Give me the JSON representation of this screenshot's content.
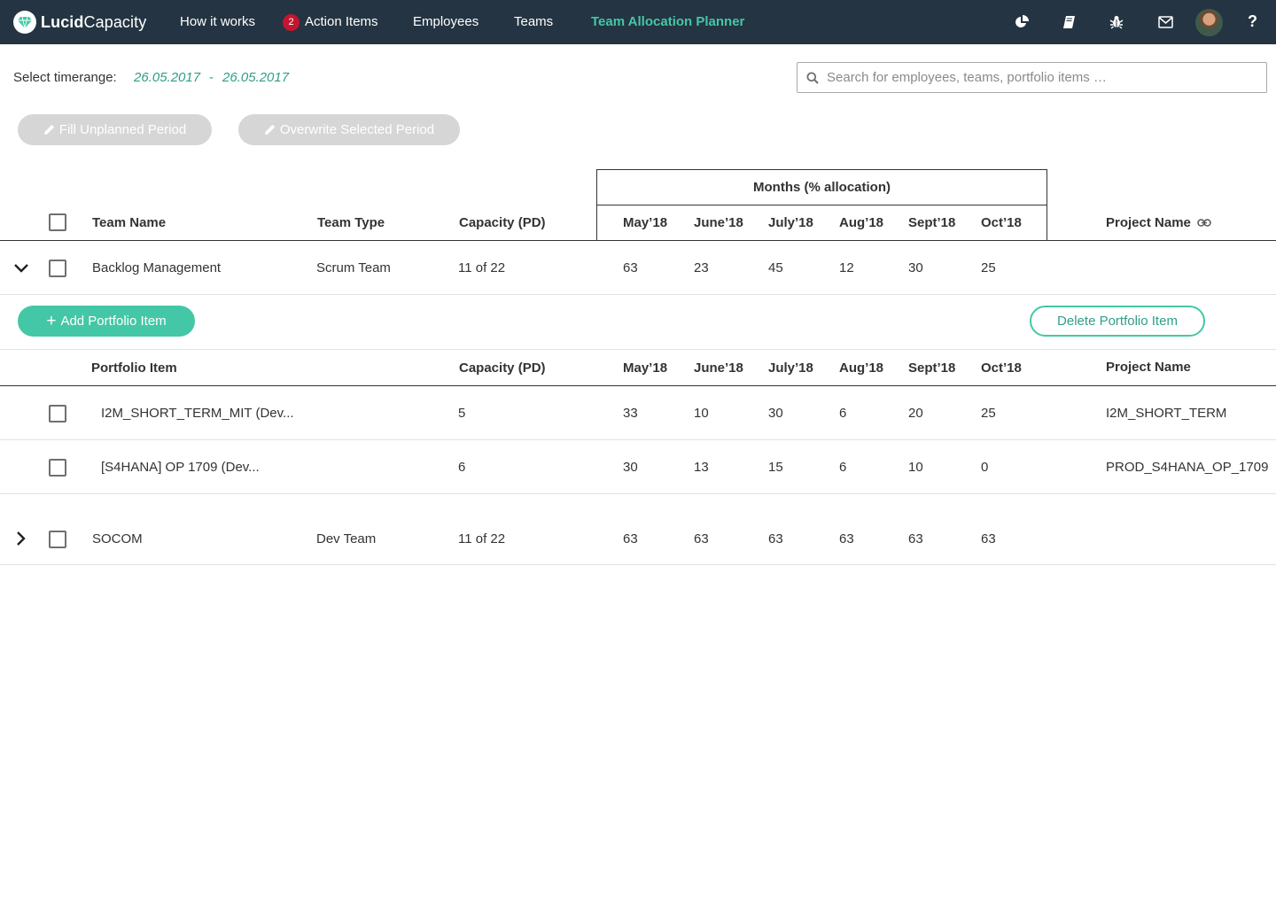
{
  "brand": {
    "name_bold": "Lucid",
    "name_light": "Capacity"
  },
  "nav": {
    "how_it_works": "How it works",
    "action_items_count": "2",
    "action_items": "Action Items",
    "employees": "Employees",
    "teams": "Teams",
    "planner": "Team Allocation Planner"
  },
  "toolbar_icons": [
    "pie-chart-icon",
    "book-icon",
    "bug-icon",
    "mail-icon",
    "avatar",
    "help-icon"
  ],
  "help_glyph": "?",
  "timerange": {
    "label": "Select timerange:",
    "from": "26.05.2017",
    "separator": "-",
    "to": "26.05.2017"
  },
  "search": {
    "placeholder": "Search for employees, teams, portfolio items …"
  },
  "actions": {
    "fill": "Fill Unplanned Period",
    "overwrite": "Overwrite Selected Period"
  },
  "table": {
    "months_caption": "Months (% allocation)",
    "headers": {
      "team_name": "Team Name",
      "team_type": "Team Type",
      "capacity": "Capacity (PD)",
      "project_name": "Project Name"
    },
    "months": [
      "May’18",
      "June’18",
      "July’18",
      "Aug’18",
      "Sept’18",
      "Oct’18"
    ],
    "teams": [
      {
        "name": "Backlog Management",
        "type": "Scrum Team",
        "capacity": "11 of 22",
        "alloc": [
          "63",
          "23",
          "45",
          "12",
          "30",
          "25"
        ],
        "expanded": true
      },
      {
        "name": "SOCOM",
        "type": "Dev Team",
        "capacity": "11 of 22",
        "alloc": [
          "63",
          "63",
          "63",
          "63",
          "63",
          "63"
        ],
        "expanded": false
      }
    ],
    "portfolio": {
      "add_label": "Add Portfolio Item",
      "delete_label": "Delete Portfolio Item",
      "headers": {
        "item": "Portfolio Item",
        "capacity": "Capacity (PD)",
        "project_name": "Project Name"
      },
      "items": [
        {
          "name": "I2M_SHORT_TERM_MIT (Dev...",
          "capacity": "5",
          "alloc": [
            "33",
            "10",
            "30",
            "6",
            "20",
            "25"
          ],
          "project": "I2M_SHORT_TERM"
        },
        {
          "name": "[S4HANA] OP 1709 (Dev...",
          "capacity": "6",
          "alloc": [
            "30",
            "13",
            "15",
            "6",
            "10",
            "0"
          ],
          "project": "PROD_S4HANA_OP_1709"
        }
      ]
    }
  },
  "colors": {
    "nav_bg": "#243442",
    "accent": "#44c7a6",
    "badge": "#c4152f",
    "disabled": "#d6d6d6"
  }
}
